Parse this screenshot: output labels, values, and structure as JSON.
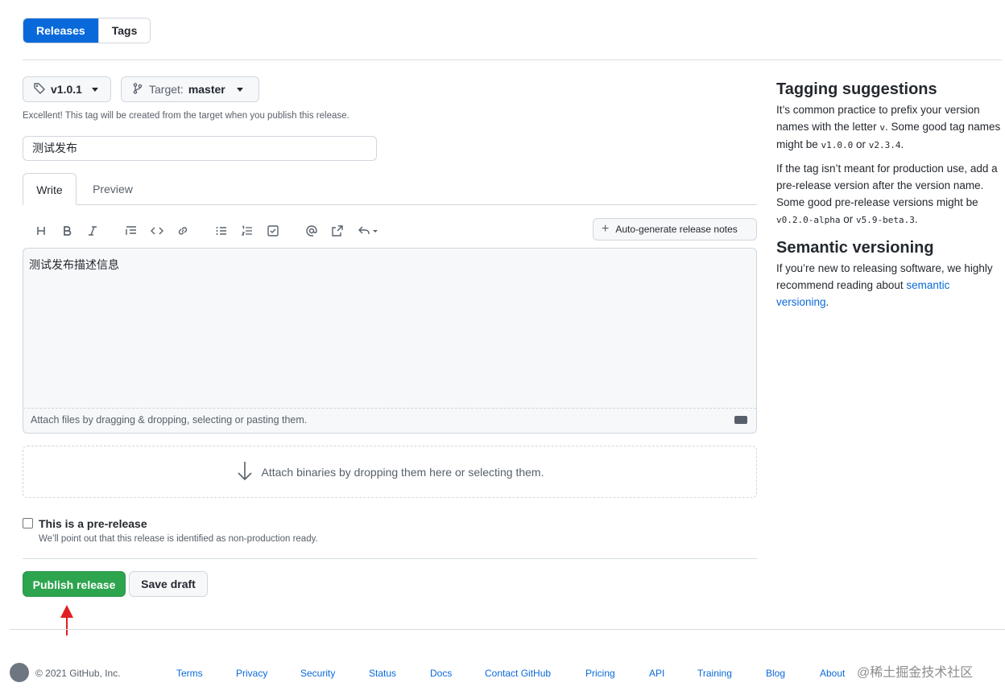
{
  "top_tabs": {
    "releases": "Releases",
    "tags": "Tags"
  },
  "tag_button": {
    "label": "v1.0.1",
    "icon": "tag-icon"
  },
  "target_button": {
    "prefix": "Target:",
    "value": "master",
    "icon": "git-branch-icon"
  },
  "tag_hint": "Excellent! This tag will be created from the target when you publish this release.",
  "release_title": {
    "value": "测试发布"
  },
  "editor_tabs": {
    "write": "Write",
    "preview": "Preview"
  },
  "toolbar": {
    "icons": [
      "heading-icon",
      "bold-icon",
      "italic-icon",
      "quote-icon",
      "code-icon",
      "link-icon",
      "unordered-list-icon",
      "ordered-list-icon",
      "task-list-icon",
      "mention-icon",
      "reference-icon",
      "reply-icon"
    ],
    "autogen_label": "Auto-generate release notes"
  },
  "editor": {
    "value": "测试发布描述信息",
    "attach_text": "Attach files by dragging & dropping, selecting or pasting them."
  },
  "dropzone": {
    "text": "Attach binaries by dropping them here or selecting them."
  },
  "prerelease": {
    "label": "This is a pre-release",
    "note": "We’ll point out that this release is identified as non-production ready.",
    "checked": false
  },
  "actions": {
    "publish": "Publish release",
    "save_draft": "Save draft"
  },
  "sidebar": {
    "tagging_title": "Tagging suggestions",
    "tagging_p1": {
      "a": "It’s common practice to prefix your version names with the letter ",
      "code1": "v",
      "b": ". Some good tag names might be ",
      "code2": "v1.0.0",
      "c": " or ",
      "code3": "v2.3.4",
      "d": "."
    },
    "tagging_p2": {
      "a": "If the tag isn’t meant for production use, add a pre-release version after the version name. Some good pre-release versions might be ",
      "code1": "v0.2.0-alpha",
      "b": " or ",
      "code2": "v5.9-beta.3",
      "c": "."
    },
    "semver_title": "Semantic versioning",
    "semver_p": {
      "a": "If you’re new to releasing software, we highly recommend reading about ",
      "link": "semantic versioning",
      "b": "."
    }
  },
  "footer": {
    "copyright": "© 2021 GitHub, Inc.",
    "links": [
      "Terms",
      "Privacy",
      "Security",
      "Status",
      "Docs",
      "Contact GitHub",
      "Pricing",
      "API",
      "Training",
      "Blog",
      "About"
    ],
    "watermark": "@稀土掘金技术社区"
  },
  "colors": {
    "primary": "#0969da",
    "publish": "#2da44e",
    "arrow": "#e02020"
  }
}
